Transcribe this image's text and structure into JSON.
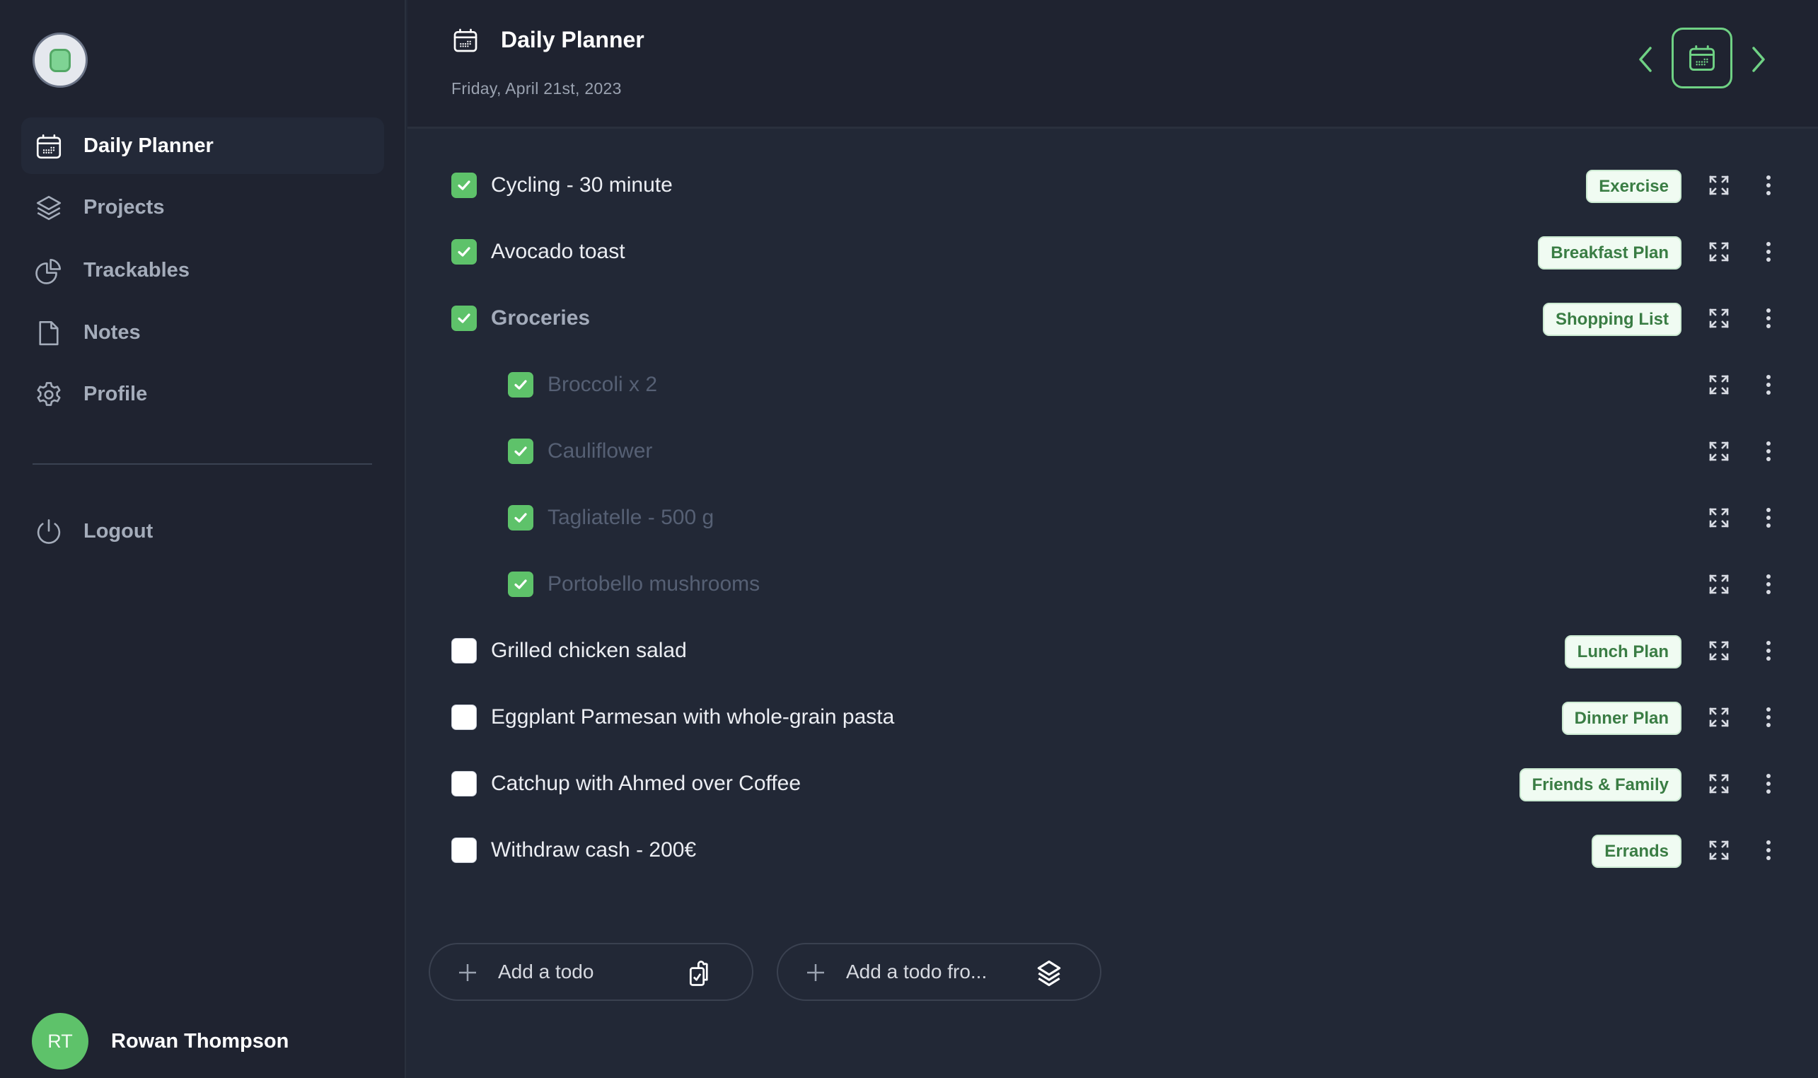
{
  "sidebar": {
    "logo": "app-logo",
    "items": [
      {
        "label": "Daily Planner",
        "icon": "calendar-icon",
        "active": true
      },
      {
        "label": "Projects",
        "icon": "layers-icon",
        "active": false
      },
      {
        "label": "Trackables",
        "icon": "pie-chart-icon",
        "active": false
      },
      {
        "label": "Notes",
        "icon": "document-icon",
        "active": false
      },
      {
        "label": "Profile",
        "icon": "gear-icon",
        "active": false
      }
    ],
    "logout": {
      "label": "Logout",
      "icon": "power-icon"
    },
    "user": {
      "initials": "RT",
      "name": "Rowan Thompson"
    }
  },
  "header": {
    "title": "Daily Planner",
    "date": "Friday, April 21st, 2023",
    "prev_icon": "chevron-left-icon",
    "calendar_icon": "calendar-icon",
    "next_icon": "chevron-right-icon"
  },
  "todos": [
    {
      "label": "Cycling - 30 minute",
      "checked": true,
      "level": 0,
      "tag": "Exercise"
    },
    {
      "label": "Avocado toast",
      "checked": true,
      "level": 0,
      "tag": "Breakfast Plan"
    },
    {
      "label": "Groceries",
      "checked": true,
      "level": 0,
      "tag": "Shopping List",
      "parent": true
    },
    {
      "label": "Broccoli x 2",
      "checked": true,
      "level": 1,
      "tag": ""
    },
    {
      "label": "Cauliflower",
      "checked": true,
      "level": 1,
      "tag": ""
    },
    {
      "label": "Tagliatelle - 500 g",
      "checked": true,
      "level": 1,
      "tag": ""
    },
    {
      "label": "Portobello mushrooms",
      "checked": true,
      "level": 1,
      "tag": ""
    },
    {
      "label": "Grilled chicken salad",
      "checked": false,
      "level": 0,
      "tag": "Lunch Plan"
    },
    {
      "label": "Eggplant Parmesan with whole-grain pasta",
      "checked": false,
      "level": 0,
      "tag": "Dinner Plan"
    },
    {
      "label": "Catchup with Ahmed over Coffee",
      "checked": false,
      "level": 0,
      "tag": "Friends & Family"
    },
    {
      "label": "Withdraw cash - 200€",
      "checked": false,
      "level": 0,
      "tag": "Errands"
    }
  ],
  "actions": {
    "add_todo": "Add a todo",
    "add_todo_from": "Add a todo fro..."
  },
  "colors": {
    "accent": "#5ec26a",
    "accent_outline": "#6fd184",
    "tag_bg": "#f0fbf2",
    "tag_text": "#3a7d44",
    "sidebar_bg": "#1f2330",
    "content_bg": "#222836"
  }
}
